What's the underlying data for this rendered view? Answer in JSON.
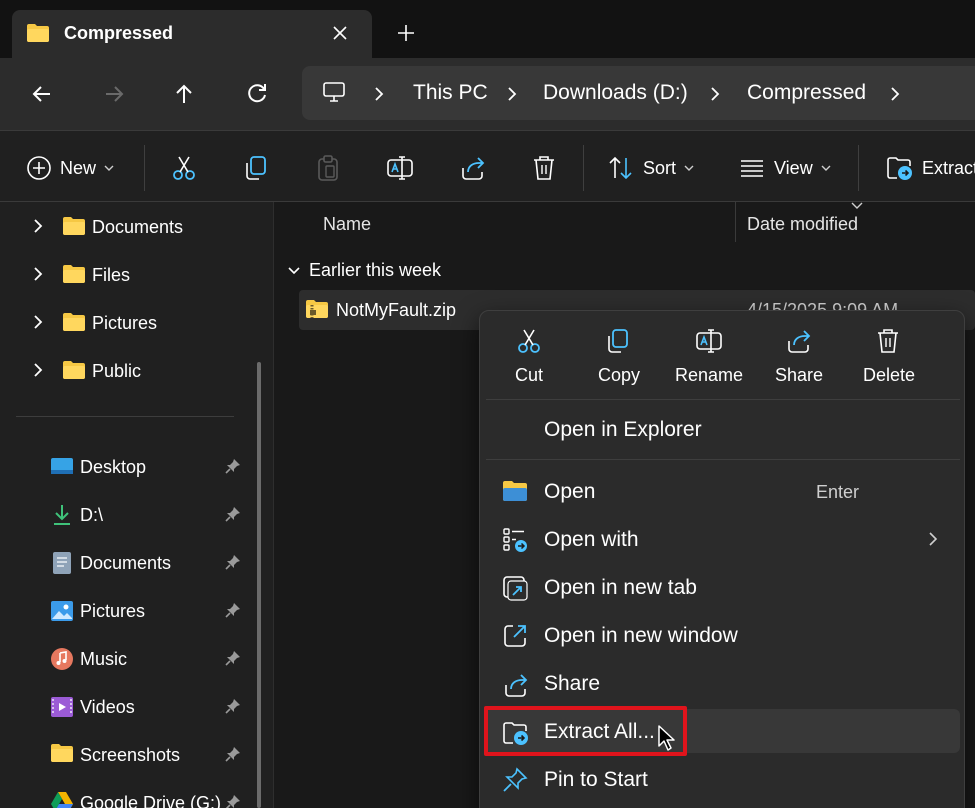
{
  "tab": {
    "title": "Compressed"
  },
  "address": {
    "crumbs": [
      "This PC",
      "Downloads (D:)",
      "Compressed"
    ]
  },
  "commands": {
    "new_label": "New",
    "sort_label": "Sort",
    "view_label": "View",
    "extract_label": "Extract"
  },
  "sidebar": {
    "tree": [
      {
        "label": "Documents"
      },
      {
        "label": "Files"
      },
      {
        "label": "Pictures"
      },
      {
        "label": "Public"
      }
    ],
    "quick": [
      {
        "label": "Desktop",
        "icon": "desktop-icon"
      },
      {
        "label": "D:\\",
        "icon": "download-icon"
      },
      {
        "label": "Documents",
        "icon": "documents-icon"
      },
      {
        "label": "Pictures",
        "icon": "pictures-icon"
      },
      {
        "label": "Music",
        "icon": "music-icon"
      },
      {
        "label": "Videos",
        "icon": "videos-icon"
      },
      {
        "label": "Screenshots",
        "icon": "folder-icon"
      },
      {
        "label": "Google Drive (G:)",
        "icon": "google-drive-icon"
      }
    ]
  },
  "content": {
    "col_name": "Name",
    "col_date": "Date modified",
    "group_label": "Earlier this week",
    "file": {
      "name": "NotMyFault.zip",
      "date": "4/15/2025 9:09 AM"
    }
  },
  "context_menu": {
    "quick_actions": [
      "Cut",
      "Copy",
      "Rename",
      "Share",
      "Delete"
    ],
    "open_in_explorer": "Open in Explorer",
    "items": [
      {
        "label": "Open",
        "accel": "Enter",
        "icon": "folder-open-icon"
      },
      {
        "label": "Open with",
        "icon": "open-with-icon"
      },
      {
        "label": "Open in new tab",
        "icon": "new-tab-icon"
      },
      {
        "label": "Open in new window",
        "icon": "new-window-icon"
      },
      {
        "label": "Share",
        "icon": "share-icon"
      },
      {
        "label": "Extract All...",
        "icon": "extract-icon"
      },
      {
        "label": "Pin to Start",
        "icon": "pin-icon"
      }
    ]
  },
  "colors": {
    "accent": "#4cc2ff",
    "folder": "#f6c844",
    "highlight": "#e0141c"
  }
}
